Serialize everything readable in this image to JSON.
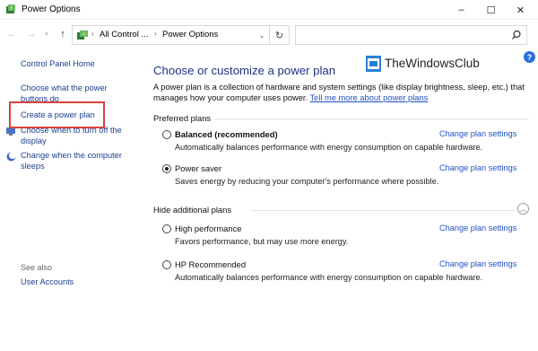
{
  "window": {
    "title": "Power Options",
    "minimize": "–",
    "maximize": "☐",
    "close": "✕"
  },
  "address": {
    "crumbs": [
      "All Control ...",
      "Power Options"
    ],
    "search_placeholder": ""
  },
  "sidebar": {
    "home": "Control Panel Home",
    "items": [
      "Choose what the power buttons do",
      "Create a power plan",
      "Choose when to turn off the display",
      "Change when the computer sleeps"
    ],
    "see_also": "See also",
    "user_accounts": "User Accounts"
  },
  "brand": "TheWindowsClub",
  "main": {
    "heading": "Choose or customize a power plan",
    "description": "A power plan is a collection of hardware and system settings (like display brightness, sleep, etc.) that manages how your computer uses power.",
    "description_link": "Tell me more about power plans",
    "preferred_label": "Preferred plans",
    "hidden_label": "Hide additional plans",
    "change_label": "Change plan settings",
    "preferred_plans": [
      {
        "name": "Balanced (recommended)",
        "desc": "Automatically balances performance with energy consumption on capable hardware.",
        "selected": false,
        "bold": true
      },
      {
        "name": "Power saver",
        "desc": "Saves energy by reducing your computer's performance where possible.",
        "selected": true,
        "bold": false
      }
    ],
    "additional_plans": [
      {
        "name": "High performance",
        "desc": "Favors performance, but may use more energy.",
        "selected": false,
        "bold": false
      },
      {
        "name": "HP Recommended",
        "desc": "Automatically balances performance with energy consumption on capable hardware.",
        "selected": false,
        "bold": false
      }
    ]
  },
  "colors": {
    "link": "#1d3f8f",
    "heading": "#1e3287",
    "highlight": "#d9433b"
  }
}
